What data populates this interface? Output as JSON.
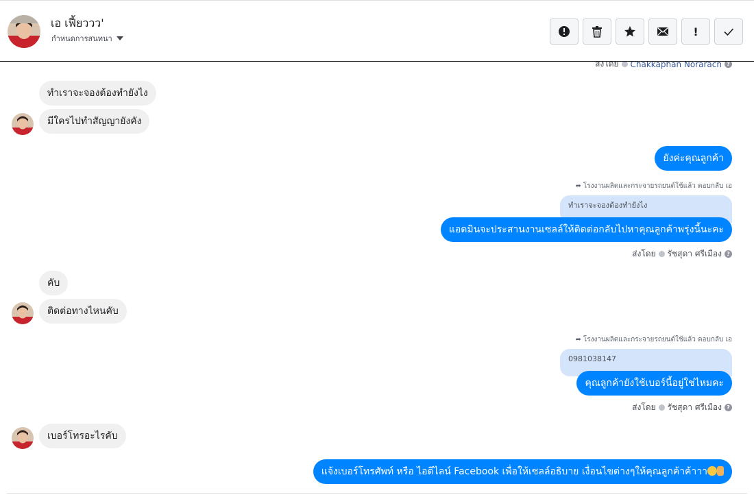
{
  "header": {
    "contact_name": "เอ เฟี้ยววว'",
    "assign_label": "กำหนดการสนทนา",
    "actions": [
      {
        "name": "mark-spam-button",
        "icon": "alert-circle-icon"
      },
      {
        "name": "delete-button",
        "icon": "trash-icon"
      },
      {
        "name": "star-button",
        "icon": "star-icon"
      },
      {
        "name": "mark-unread-button",
        "icon": "envelope-icon"
      },
      {
        "name": "follow-up-button",
        "icon": "exclamation-icon"
      },
      {
        "name": "mark-done-button",
        "icon": "check-icon"
      }
    ]
  },
  "messages": {
    "top_sent_by": {
      "prefix": "ส่งโดย",
      "sender": "Chakkaphan Noraracn"
    },
    "in_1": "ทำเราจะจองต้องทำยังไง",
    "in_2": "มีใครไปทำสัญญายังคัง",
    "out_1": "ยังค่ะคุณลูกค้า",
    "reply_note_1": "โรงงานผลิตและกระจายรถยนต์ใช้แล้ว ตอบกลับ เอ",
    "quote_1": "ทำเราจะจองต้องทำยังไง",
    "out_2": "แอดมินจะประสานงานเซลล์ให้ติดต่อกลับไปหาคุณลูกค้าพรุ่งนี้นะคะ",
    "sent_by_1": {
      "prefix": "ส่งโดย",
      "sender": "รัชสุดา ศรีเมือง"
    },
    "in_3": "คับ",
    "in_4": "ติดต่อทางไหนคับ",
    "reply_note_2": "โรงงานผลิตและกระจายรถยนต์ใช้แล้ว ตอบกลับ เอ",
    "quote_2": "0981038147",
    "out_3": "คุณลูกค้ายังใช้เบอร์นี้อยู่ใช่ไหมคะ",
    "sent_by_2": {
      "prefix": "ส่งโดย",
      "sender": "รัชสุดา ศรีเมือง"
    },
    "in_5": "เบอร์โทรอะไรคับ",
    "out_4": "แจ้งเบอร์โทรศัพท์ หรือ ไอดีไลน์  Facebook   เพื่อให้เซลล์อธิบาย เงื่อนไขต่างๆให้คุณลูกค้าค้าาา"
  },
  "colors": {
    "outgoing_bubble": "#0084ff",
    "incoming_bubble": "#f1f0f0",
    "quote_bubble": "#d4e4fb",
    "sender_link": "#385898"
  }
}
